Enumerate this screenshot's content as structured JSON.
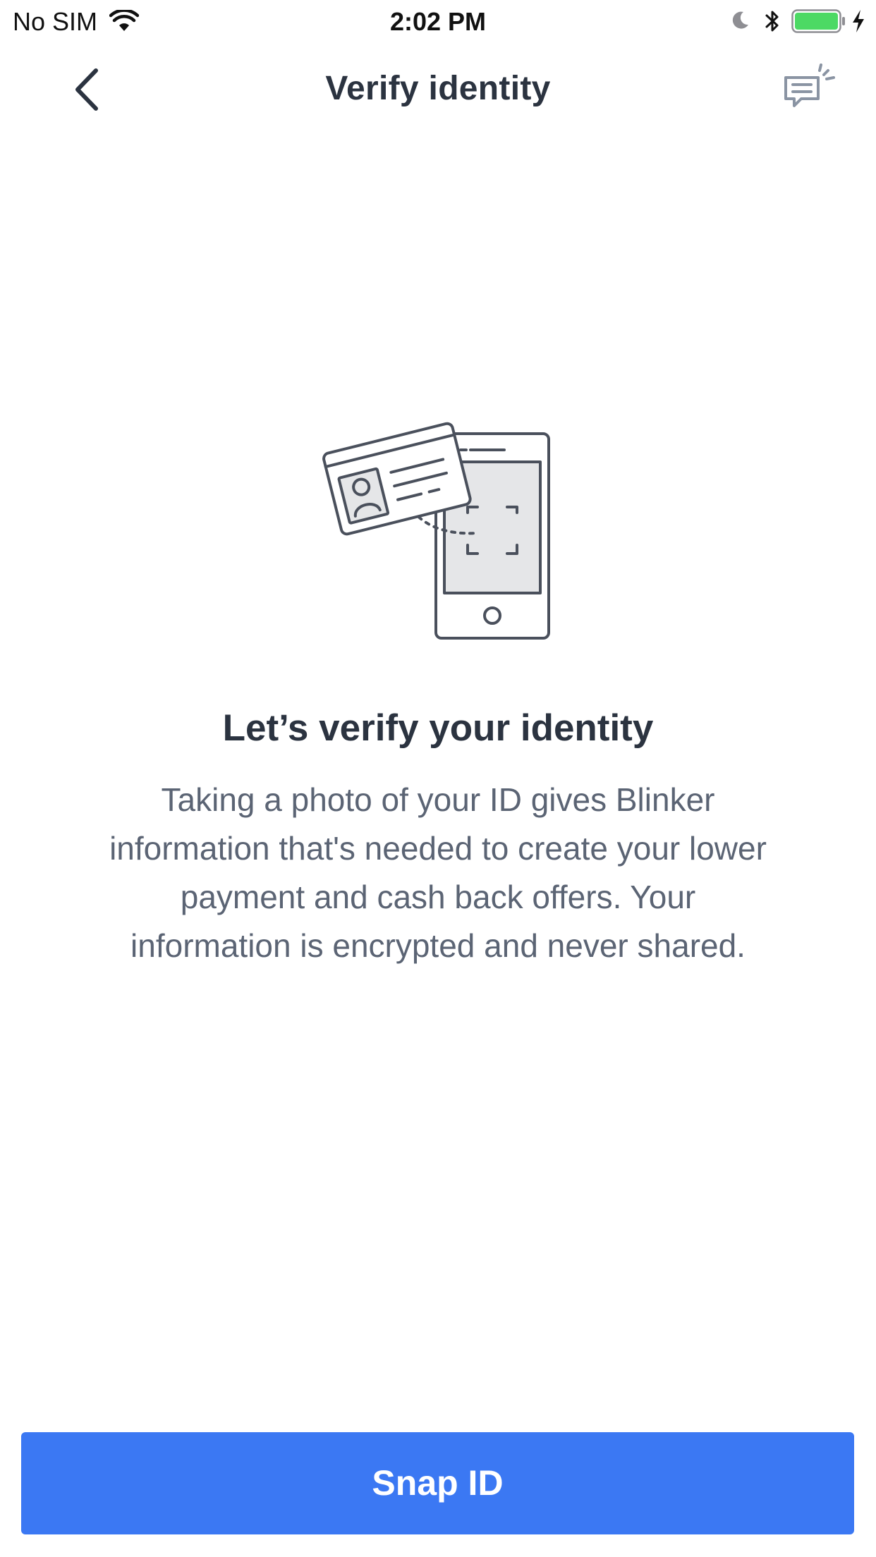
{
  "status_bar": {
    "carrier": "No SIM",
    "time": "2:02 PM",
    "battery_color": "#4cd964"
  },
  "nav": {
    "title": "Verify identity",
    "back_icon": "chevron-left-icon",
    "chat_icon": "chat-bubble-icon"
  },
  "illustration": {
    "icon": "id-card-phone-scan-icon",
    "stroke_color": "#4a505c",
    "screen_fill": "#e5e6e8"
  },
  "content": {
    "heading": "Let’s verify your identity",
    "body": "Taking a photo of your ID gives Blinker information that's needed to create your lower payment and cash back offers. Your information is encrypted and never shared."
  },
  "primary_button": {
    "label": "Snap ID",
    "color": "#3b78f3"
  }
}
